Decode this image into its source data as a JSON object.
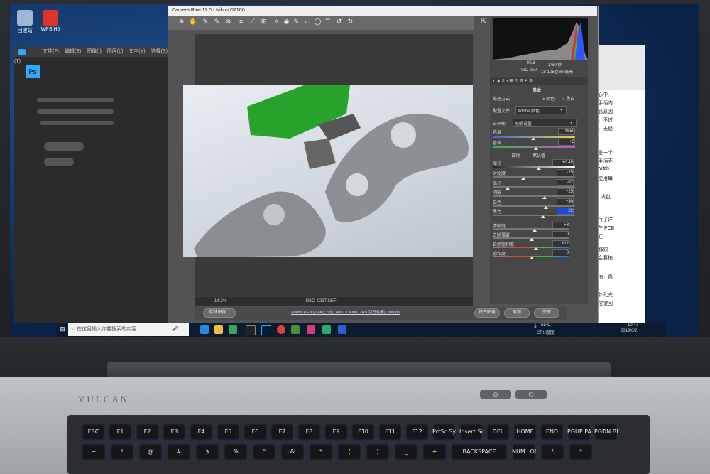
{
  "desktop": {
    "icons": [
      {
        "label": "回收站",
        "color": "#9fb6d6"
      },
      {
        "label": "WPS H5",
        "color": "#e0322c"
      }
    ]
  },
  "photoshop": {
    "logo": "Ps",
    "menu": [
      "文件(F)",
      "编辑(E)",
      "图像(I)",
      "图层(L)",
      "文字(Y)",
      "选择(S)",
      "滤镜(T)"
    ]
  },
  "camera_raw": {
    "title": "Camera Raw 11.0  -  Nikon D7100",
    "zoom": "14.2%",
    "filename": "DSC_0237.NEF",
    "info_line": "Adobe RGB (1998); 8 位; 6000 x 4000 (24.0 百万像素); 300 ppi",
    "buttons": {
      "save": "存储图像...",
      "open": "打开图像",
      "cancel": "取消",
      "done": "完成"
    },
    "camera_info": {
      "aperture": "f/5.6",
      "shutter": "1/60 秒",
      "iso": "ISO 250",
      "lens": "18-105@66 毫米"
    },
    "panel": {
      "section_title": "基本",
      "treatment_label": "处理方式:",
      "treatment_color": "颜色",
      "treatment_bw": "黑白",
      "profile_label": "配置文件:",
      "profile_value": "Adobe 颜色",
      "wb_label": "白平衡:",
      "wb_value": "原照设置",
      "auto": "自动",
      "default": "默认值",
      "temp": {
        "label": "色温",
        "value": "4850"
      },
      "tint": {
        "label": "色调",
        "value": "+3"
      },
      "exposure": {
        "label": "曝光",
        "value": "+0.45"
      },
      "contrast": {
        "label": "对比度",
        "value": "-25"
      },
      "highlights": {
        "label": "高光",
        "value": "-67"
      },
      "shadows": {
        "label": "阴影",
        "value": "+25"
      },
      "whites": {
        "label": "白色",
        "value": "+30"
      },
      "blacks": {
        "label": "黑色",
        "value": "+22"
      },
      "clarity": {
        "label": "清晰度",
        "value": "+8"
      },
      "dehaze": {
        "label": "去除薄雾",
        "value": "0"
      },
      "vibrance": {
        "label": "自然饱和度",
        "value": "+12"
      },
      "saturation": {
        "label": "饱和度",
        "value": "0"
      }
    }
  },
  "word": {
    "lines": [
      "心中,",
      "手柄内",
      "品原因",
      "。不过",
      "，无疑",
      "是一个",
      "手柄壳",
      "witch-",
      "使用每",
      ", 内包",
      "行了详",
      "在 PCB",
      "汇",
      "'像瓜",
      "会要拍",
      "柄，真",
      "卦孔完",
      "按键回"
    ]
  },
  "taskbar": {
    "search_placeholder": "在这里输入你要搜索的内容",
    "temp": "55°C",
    "temp_label": "CPU温度",
    "time": "10:47",
    "date": "2019/6/2"
  },
  "laptop": {
    "brand": "VULCAN"
  },
  "keyboard": {
    "row1": [
      "ESC",
      "F1",
      "F2",
      "F3",
      "F4",
      "F5",
      "F6",
      "F7",
      "F8",
      "F9",
      "F10",
      "F11",
      "F12",
      "PrtSc SysRq",
      "Insert ScrLk",
      "DEL",
      "HOME",
      "END",
      "PGUP PAUSE",
      "PGDN BREAK"
    ],
    "row2": [
      "~",
      "!",
      "@",
      "#",
      "$",
      "%",
      "^",
      "&",
      "*",
      "(",
      ")",
      "_",
      "+",
      "BACKSPACE",
      "NUM LOCK",
      "/",
      "*"
    ]
  }
}
